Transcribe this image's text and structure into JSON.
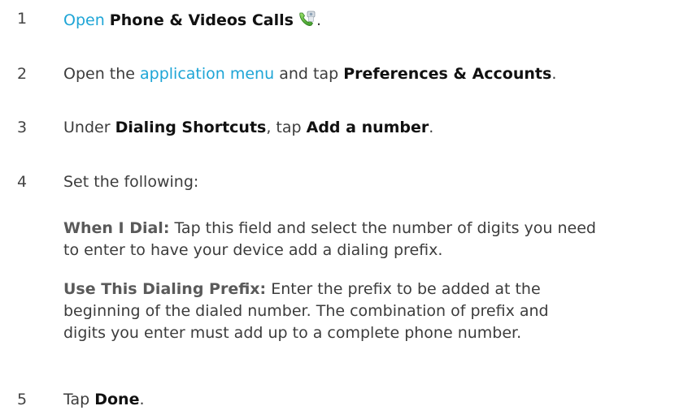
{
  "steps": [
    {
      "number": "1",
      "open_link": "Open",
      "app_name": "Phone & Videos Calls",
      "app_icon": "phone-app-icon",
      "end": "."
    },
    {
      "number": "2",
      "prefix": "Open the",
      "menu_link": "application menu",
      "middle": "and tap",
      "target": "Preferences & Accounts",
      "end": "."
    },
    {
      "number": "3",
      "prefix": "Under",
      "section": "Dialing Shortcuts",
      "middle": ", tap",
      "target": "Add a number",
      "end": "."
    },
    {
      "number": "4",
      "text": "Set the following:",
      "fields": [
        {
          "name": "When I Dial:",
          "line1": "Tap this field and select the number of digits you need",
          "line2": "to enter to have your device add a dialing prefix."
        },
        {
          "name": "Use This Dialing Prefix:",
          "line1": "Enter the prefix to be added at the",
          "line2": "beginning of the dialed number. The combination of prefix and",
          "line3": "digits you enter must add up to a complete phone number."
        }
      ]
    },
    {
      "number": "5",
      "prefix": "Tap",
      "target": "Done",
      "end": "."
    }
  ],
  "colors": {
    "link": "#1ea5d6",
    "text": "#3c3c3c",
    "bold": "#111111"
  }
}
